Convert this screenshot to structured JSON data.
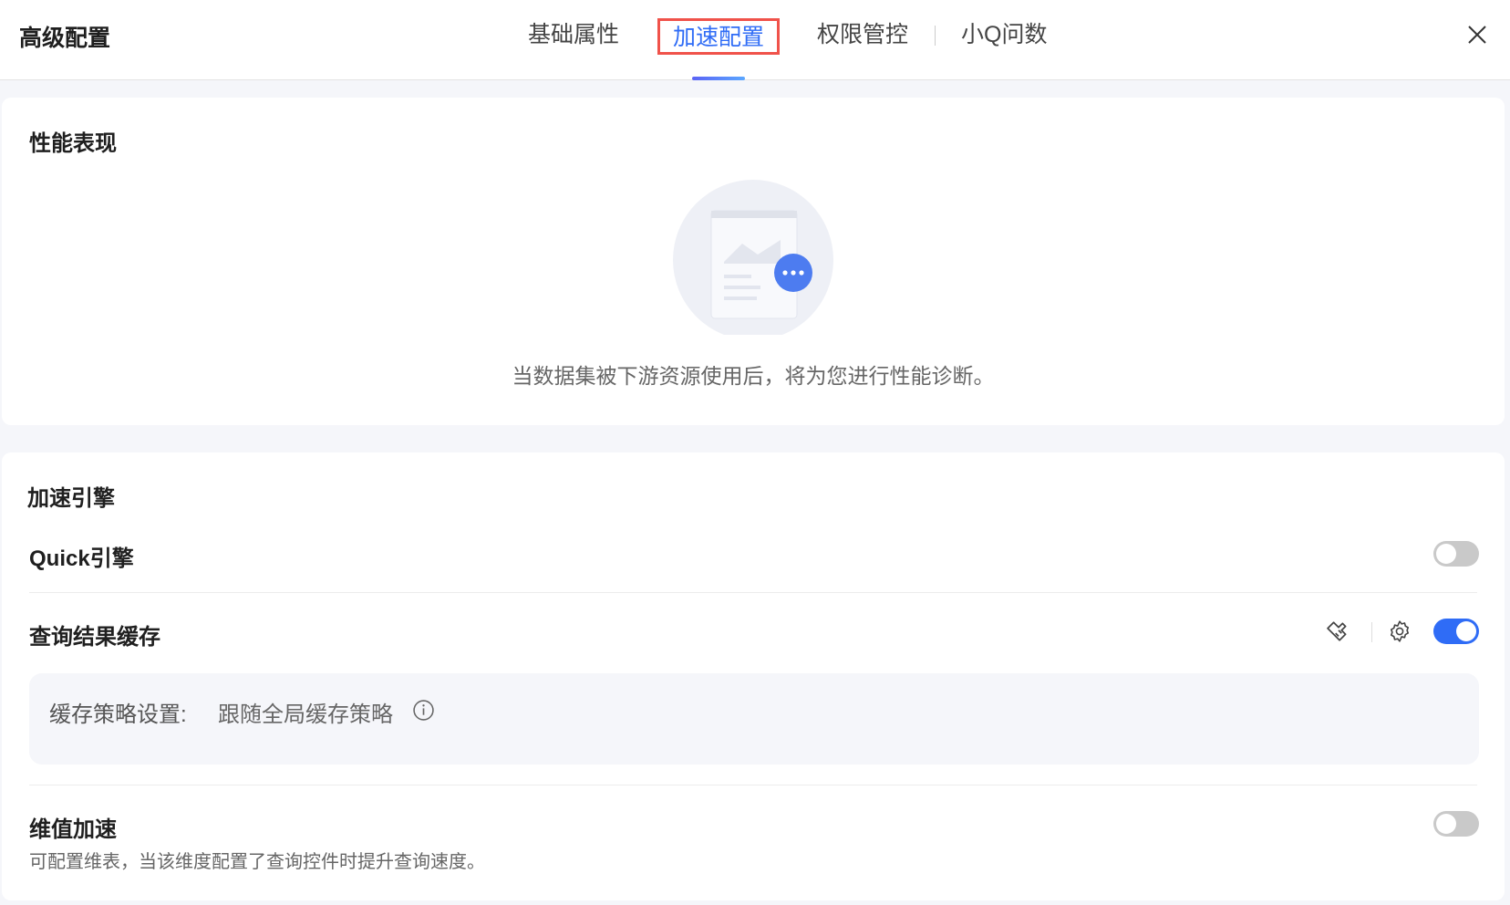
{
  "header": {
    "title": "高级配置",
    "tabs": [
      {
        "label": "基础属性"
      },
      {
        "label": "加速配置",
        "active": true
      },
      {
        "label": "权限管控"
      },
      {
        "label": "小Q问数"
      }
    ]
  },
  "performance": {
    "title": "性能表现",
    "empty_text": "当数据集被下游资源使用后，将为您进行性能诊断。"
  },
  "acceleration": {
    "title": "加速引擎",
    "quick": {
      "label": "Quick引擎",
      "enabled": false
    },
    "cache": {
      "label": "查询结果缓存",
      "enabled": true,
      "strategy_label": "缓存策略设置:",
      "strategy_value": "跟随全局缓存策略"
    },
    "dim": {
      "label": "维值加速",
      "enabled": false,
      "description": "可配置维表，当该维度配置了查询控件时提升查询速度。"
    }
  },
  "colors": {
    "accent": "#2f6cf6",
    "highlight_box": "#f0524a"
  }
}
